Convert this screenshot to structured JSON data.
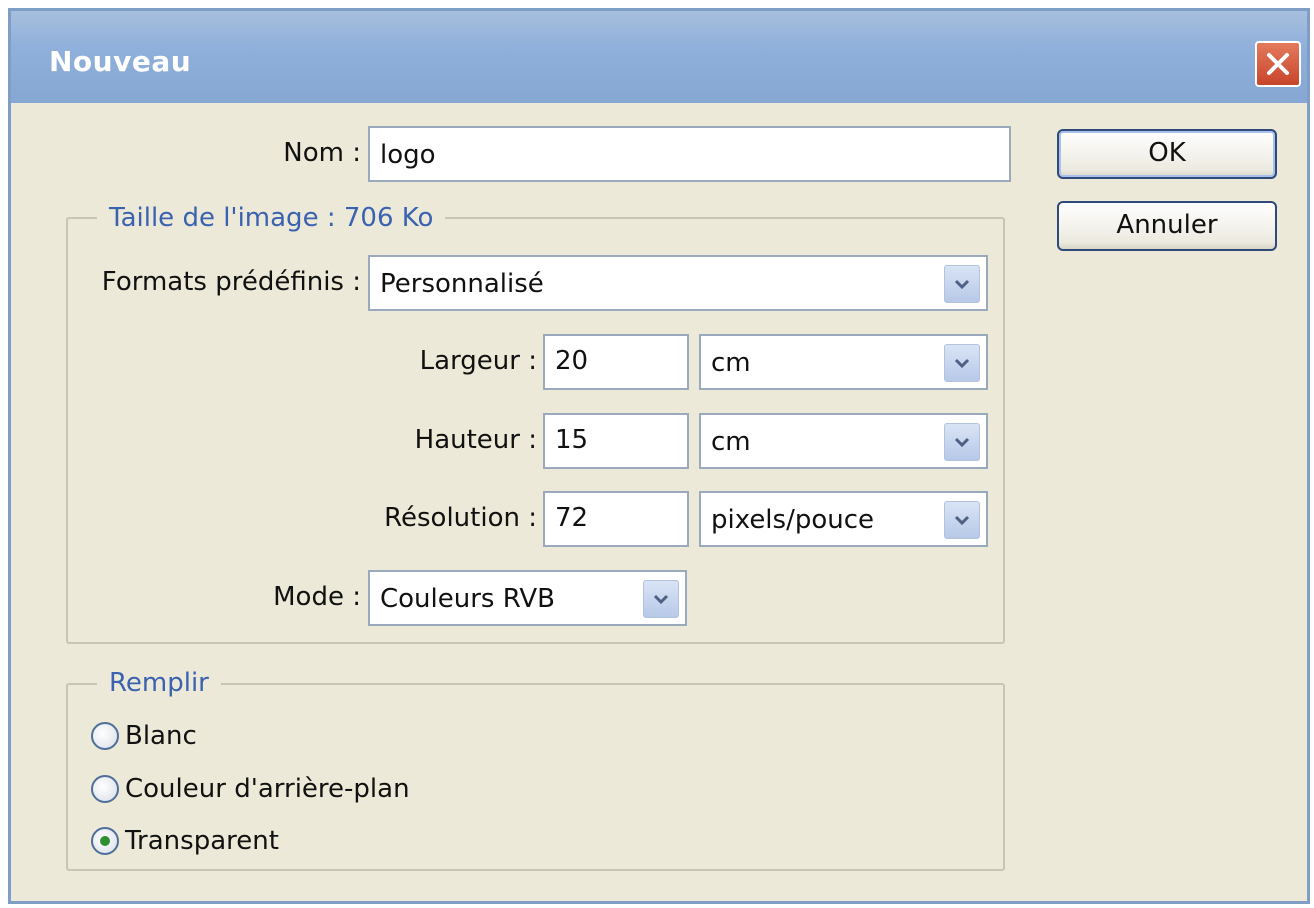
{
  "dialog": {
    "title": "Nouveau",
    "close_icon": "close-icon"
  },
  "name_field": {
    "label": "Nom :",
    "value": "logo"
  },
  "buttons": {
    "ok": "OK",
    "cancel": "Annuler"
  },
  "image_size": {
    "legend": "Taille de l'image :",
    "size_value": "706 Ko",
    "preset": {
      "label": "Formats prédéfinis :",
      "value": "Personnalisé"
    },
    "width": {
      "label": "Largeur :",
      "value": "20",
      "unit": "cm"
    },
    "height": {
      "label": "Hauteur :",
      "value": "15",
      "unit": "cm"
    },
    "resolution": {
      "label": "Résolution :",
      "value": "72",
      "unit": "pixels/pouce"
    },
    "mode": {
      "label": "Mode :",
      "value": "Couleurs RVB"
    }
  },
  "fill": {
    "legend": "Remplir",
    "options": [
      {
        "label": "Blanc",
        "selected": false
      },
      {
        "label": "Couleur d'arrière-plan",
        "selected": false
      },
      {
        "label": "Transparent",
        "selected": true
      }
    ]
  },
  "colors": {
    "title_bar": "#8fb0da",
    "dialog_bg": "#ece9d8",
    "legend_text": "#3a62b0",
    "close_button": "#c8452b"
  }
}
